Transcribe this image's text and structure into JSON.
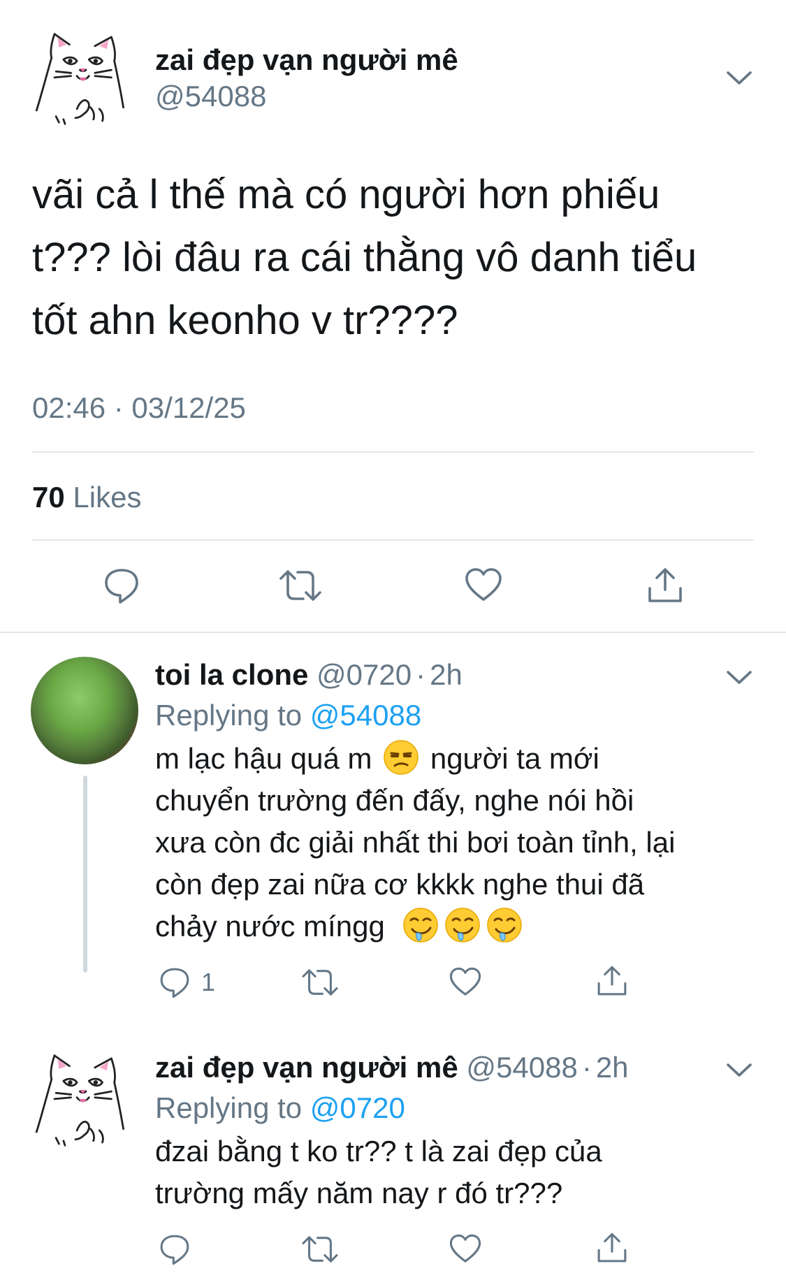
{
  "tweet": {
    "author_name": "zai đẹp vạn người mê",
    "author_handle": "@54088",
    "text_lines": [
      "vãi cả l thế mà có người hơn phiếu",
      "t??? lòi đâu ra cái thằng vô danh tiểu",
      "tốt ahn keonho v tr????"
    ],
    "timestamp": "02:46 · 03/12/25",
    "likes_count": "70",
    "likes_label": "Likes"
  },
  "reply1": {
    "author_name": "toi la clone",
    "author_handle": "@0720",
    "separator": "·",
    "time": "2h",
    "replying_label": "Replying to",
    "replying_handle": "@54088",
    "line1_a": "m lạc hậu quá m",
    "line1_b": "người ta mới",
    "line2": "chuyển trường đến đấy, nghe nói hồi",
    "line3": "xưa còn đc giải nhất thi bơi toàn tỉnh, lại",
    "line4": "còn đẹp zai nữa cơ kkkk nghe thui đã",
    "line5": "chảy nước míngg",
    "emoji_1": "unamused-face",
    "emoji_2": "drooling-face",
    "reply_count": "1"
  },
  "reply2": {
    "author_name": "zai đẹp vạn người mê",
    "author_handle": "@54088",
    "separator": "·",
    "time": "2h",
    "replying_label": "Replying to",
    "replying_handle": "@0720",
    "line1": "đzai bằng t ko tr?? t là zai đẹp của",
    "line2": "trường mấy năm nay r đó tr???"
  },
  "icons": {
    "reply": "reply-icon",
    "retweet": "retweet-icon",
    "like": "heart-icon",
    "share": "share-icon",
    "chevron": "chevron-down-icon"
  },
  "colors": {
    "text": "#14171a",
    "secondary": "#657786",
    "link": "#1da1f2",
    "divider": "#e1e8ed"
  }
}
